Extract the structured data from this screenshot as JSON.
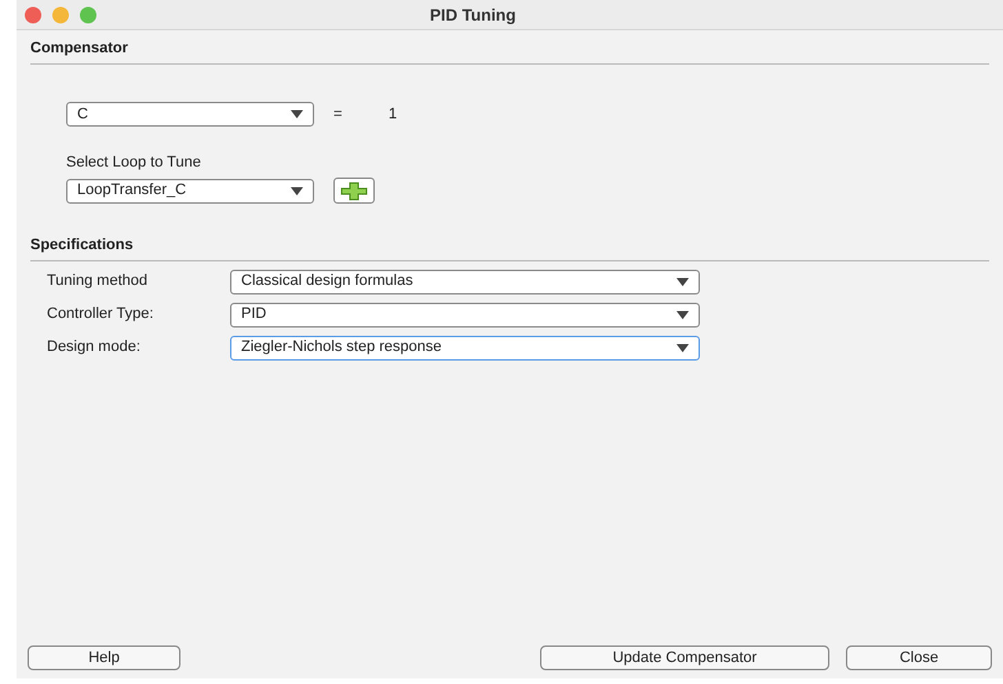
{
  "window": {
    "title": "PID Tuning"
  },
  "compensator": {
    "heading": "Compensator",
    "selector": {
      "value": "C"
    },
    "equals": "=",
    "value": "1",
    "loop_label": "Select Loop to Tune",
    "loop_selector": {
      "value": "LoopTransfer_C"
    }
  },
  "specifications": {
    "heading": "Specifications",
    "rows": [
      {
        "label": "Tuning method",
        "value": "Classical design formulas",
        "focused": false
      },
      {
        "label": "Controller Type:",
        "value": "PID",
        "focused": false
      },
      {
        "label": "Design mode:",
        "value": "Ziegler-Nichols step response",
        "focused": true
      }
    ]
  },
  "buttons": {
    "help": "Help",
    "update": "Update Compensator",
    "close": "Close"
  }
}
